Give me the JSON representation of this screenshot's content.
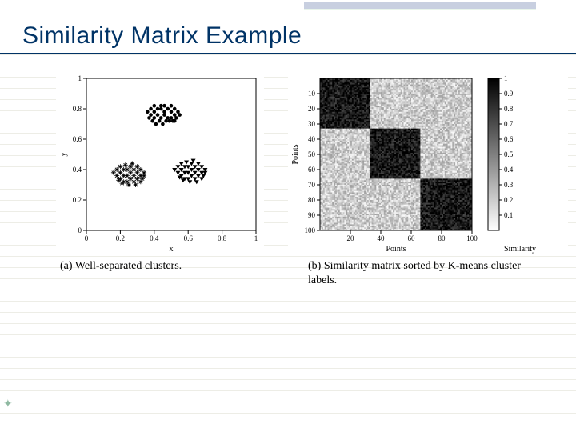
{
  "slide": {
    "title": "Similarity Matrix Example"
  },
  "figures": {
    "a": {
      "caption_label": "(a)",
      "caption_text": "Well-separated clusters.",
      "xlabel": "x",
      "ylabel": "y"
    },
    "b": {
      "caption_label": "(b)",
      "caption_text": "Similarity matrix sorted by K-means cluster labels.",
      "xlabel": "Points",
      "ylabel": "Points",
      "colorbar_label": "Similarity"
    }
  },
  "chart_data": [
    {
      "type": "scatter",
      "title": "Well-separated clusters",
      "xlabel": "x",
      "ylabel": "y",
      "xlim": [
        0,
        1
      ],
      "ylim": [
        0,
        1
      ],
      "x_ticks": [
        0,
        0.2,
        0.4,
        0.6,
        0.8,
        1
      ],
      "y_ticks": [
        0,
        0.2,
        0.4,
        0.6,
        0.8,
        1
      ],
      "series": [
        {
          "name": "Cluster 1 (dots)",
          "marker": "dot",
          "points": [
            [
              0.4,
              0.78
            ],
            [
              0.42,
              0.8
            ],
            [
              0.44,
              0.82
            ],
            [
              0.46,
              0.78
            ],
            [
              0.48,
              0.8
            ],
            [
              0.38,
              0.76
            ],
            [
              0.4,
              0.74
            ],
            [
              0.42,
              0.76
            ],
            [
              0.44,
              0.74
            ],
            [
              0.46,
              0.76
            ],
            [
              0.48,
              0.74
            ],
            [
              0.5,
              0.78
            ],
            [
              0.52,
              0.8
            ],
            [
              0.5,
              0.74
            ],
            [
              0.52,
              0.76
            ],
            [
              0.38,
              0.8
            ],
            [
              0.4,
              0.82
            ],
            [
              0.36,
              0.78
            ],
            [
              0.54,
              0.78
            ],
            [
              0.5,
              0.82
            ],
            [
              0.45,
              0.7
            ],
            [
              0.47,
              0.72
            ],
            [
              0.49,
              0.72
            ],
            [
              0.51,
              0.72
            ],
            [
              0.43,
              0.72
            ],
            [
              0.41,
              0.7
            ],
            [
              0.53,
              0.74
            ],
            [
              0.37,
              0.74
            ],
            [
              0.39,
              0.72
            ],
            [
              0.55,
              0.76
            ],
            [
              0.52,
              0.72
            ],
            [
              0.44,
              0.8
            ],
            [
              0.46,
              0.82
            ]
          ]
        },
        {
          "name": "Cluster 2 (stars)",
          "marker": "star",
          "points": [
            [
              0.2,
              0.38
            ],
            [
              0.22,
              0.4
            ],
            [
              0.24,
              0.36
            ],
            [
              0.26,
              0.38
            ],
            [
              0.28,
              0.4
            ],
            [
              0.18,
              0.36
            ],
            [
              0.2,
              0.34
            ],
            [
              0.22,
              0.36
            ],
            [
              0.24,
              0.4
            ],
            [
              0.26,
              0.34
            ],
            [
              0.28,
              0.36
            ],
            [
              0.3,
              0.38
            ],
            [
              0.32,
              0.4
            ],
            [
              0.3,
              0.34
            ],
            [
              0.32,
              0.36
            ],
            [
              0.18,
              0.4
            ],
            [
              0.16,
              0.38
            ],
            [
              0.34,
              0.38
            ],
            [
              0.24,
              0.32
            ],
            [
              0.26,
              0.42
            ],
            [
              0.28,
              0.32
            ],
            [
              0.3,
              0.42
            ],
            [
              0.22,
              0.32
            ],
            [
              0.2,
              0.42
            ],
            [
              0.32,
              0.32
            ],
            [
              0.34,
              0.36
            ],
            [
              0.33,
              0.34
            ],
            [
              0.19,
              0.33
            ],
            [
              0.21,
              0.31
            ],
            [
              0.23,
              0.43
            ],
            [
              0.25,
              0.3
            ],
            [
              0.27,
              0.44
            ],
            [
              0.29,
              0.3
            ]
          ]
        },
        {
          "name": "Cluster 3 (triangles)",
          "marker": "triangle-down",
          "points": [
            [
              0.56,
              0.4
            ],
            [
              0.58,
              0.42
            ],
            [
              0.6,
              0.38
            ],
            [
              0.62,
              0.4
            ],
            [
              0.64,
              0.42
            ],
            [
              0.54,
              0.38
            ],
            [
              0.56,
              0.36
            ],
            [
              0.58,
              0.38
            ],
            [
              0.6,
              0.42
            ],
            [
              0.62,
              0.36
            ],
            [
              0.64,
              0.38
            ],
            [
              0.66,
              0.4
            ],
            [
              0.68,
              0.42
            ],
            [
              0.66,
              0.36
            ],
            [
              0.68,
              0.38
            ],
            [
              0.54,
              0.42
            ],
            [
              0.52,
              0.4
            ],
            [
              0.7,
              0.4
            ],
            [
              0.6,
              0.34
            ],
            [
              0.62,
              0.44
            ],
            [
              0.64,
              0.34
            ],
            [
              0.66,
              0.44
            ],
            [
              0.58,
              0.34
            ],
            [
              0.56,
              0.44
            ],
            [
              0.68,
              0.34
            ],
            [
              0.7,
              0.38
            ],
            [
              0.69,
              0.36
            ],
            [
              0.55,
              0.35
            ],
            [
              0.57,
              0.33
            ],
            [
              0.59,
              0.45
            ],
            [
              0.61,
              0.32
            ],
            [
              0.63,
              0.46
            ],
            [
              0.65,
              0.32
            ]
          ]
        }
      ]
    },
    {
      "type": "heatmap",
      "title": "Similarity matrix sorted by K-means cluster labels",
      "xlabel": "Points",
      "ylabel": "Points",
      "x_ticks": [
        20,
        40,
        60,
        80,
        100
      ],
      "y_ticks": [
        10,
        20,
        30,
        40,
        50,
        60,
        70,
        80,
        90,
        100
      ],
      "colorbar_ticks": [
        0.1,
        0.2,
        0.3,
        0.4,
        0.5,
        0.6,
        0.7,
        0.8,
        0.9,
        1
      ],
      "colormap": "gray",
      "n_points": 100,
      "cluster_bounds": [
        [
          1,
          33
        ],
        [
          34,
          66
        ],
        [
          67,
          100
        ]
      ],
      "block_similarity": {
        "within": 0.9,
        "between": 0.2
      }
    }
  ]
}
